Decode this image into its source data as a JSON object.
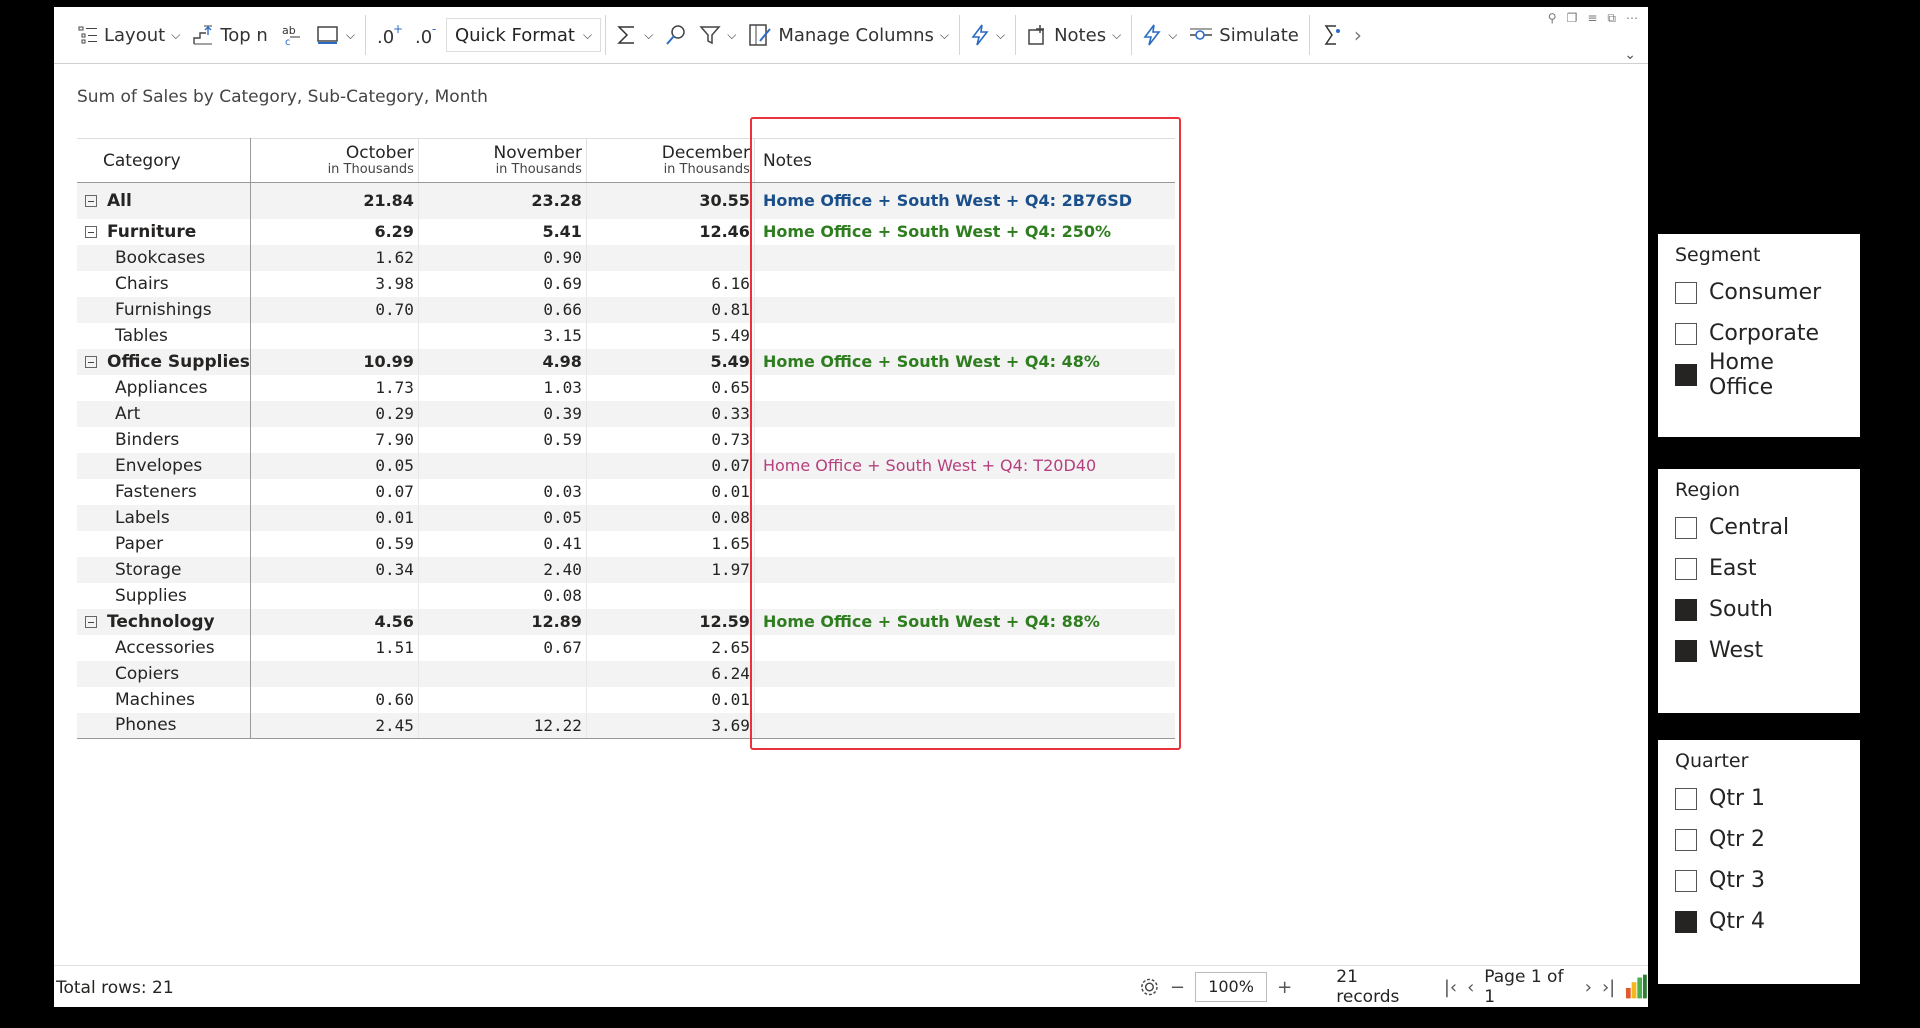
{
  "toolbar": {
    "layout": "Layout",
    "topn": "Top n",
    "quick_format": "Quick Format",
    "manage_columns": "Manage Columns",
    "notes": "Notes",
    "simulate": "Simulate"
  },
  "title": "Sum of Sales by Category, Sub-Category, Month",
  "table": {
    "category_header": "Category",
    "notes_header": "Notes",
    "columns": [
      {
        "month": "October",
        "unit": "in Thousands"
      },
      {
        "month": "November",
        "unit": "in Thousands"
      },
      {
        "month": "December",
        "unit": "in Thousands"
      }
    ],
    "rows": [
      {
        "label": "All",
        "level": 0,
        "v": [
          "21.84",
          "23.28",
          "30.55"
        ],
        "note": "Home Office + South West + Q4: 2B76SD",
        "note_color": "#1a4f8a"
      },
      {
        "label": "Furniture",
        "level": 0,
        "v": [
          "6.29",
          "5.41",
          "12.46"
        ],
        "note": "Home Office + South West + Q4: 250%",
        "note_color": "#2e7d1f"
      },
      {
        "label": "Bookcases",
        "level": 1,
        "v": [
          "1.62",
          "0.90",
          ""
        ],
        "note": ""
      },
      {
        "label": "Chairs",
        "level": 1,
        "v": [
          "3.98",
          "0.69",
          "6.16"
        ],
        "note": ""
      },
      {
        "label": "Furnishings",
        "level": 1,
        "v": [
          "0.70",
          "0.66",
          "0.81"
        ],
        "note": ""
      },
      {
        "label": "Tables",
        "level": 1,
        "v": [
          "",
          "3.15",
          "5.49"
        ],
        "note": ""
      },
      {
        "label": "Office Supplies",
        "level": 0,
        "v": [
          "10.99",
          "4.98",
          "5.49"
        ],
        "note": "Home Office + South West + Q4: 48%",
        "note_color": "#2e7d1f"
      },
      {
        "label": "Appliances",
        "level": 1,
        "v": [
          "1.73",
          "1.03",
          "0.65"
        ],
        "note": ""
      },
      {
        "label": "Art",
        "level": 1,
        "v": [
          "0.29",
          "0.39",
          "0.33"
        ],
        "note": ""
      },
      {
        "label": "Binders",
        "level": 1,
        "v": [
          "7.90",
          "0.59",
          "0.73"
        ],
        "note": ""
      },
      {
        "label": "Envelopes",
        "level": 1,
        "v": [
          "0.05",
          "",
          "0.07"
        ],
        "note": "Home Office + South West + Q4: T20D40",
        "note_color": "#b5407e"
      },
      {
        "label": "Fasteners",
        "level": 1,
        "v": [
          "0.07",
          "0.03",
          "0.01"
        ],
        "note": ""
      },
      {
        "label": "Labels",
        "level": 1,
        "v": [
          "0.01",
          "0.05",
          "0.08"
        ],
        "note": ""
      },
      {
        "label": "Paper",
        "level": 1,
        "v": [
          "0.59",
          "0.41",
          "1.65"
        ],
        "note": ""
      },
      {
        "label": "Storage",
        "level": 1,
        "v": [
          "0.34",
          "2.40",
          "1.97"
        ],
        "note": ""
      },
      {
        "label": "Supplies",
        "level": 1,
        "v": [
          "",
          "0.08",
          ""
        ],
        "note": ""
      },
      {
        "label": "Technology",
        "level": 0,
        "v": [
          "4.56",
          "12.89",
          "12.59"
        ],
        "note": "Home Office + South West + Q4: 88%",
        "note_color": "#2e7d1f"
      },
      {
        "label": "Accessories",
        "level": 1,
        "v": [
          "1.51",
          "0.67",
          "2.65"
        ],
        "note": ""
      },
      {
        "label": "Copiers",
        "level": 1,
        "v": [
          "",
          "",
          "6.24"
        ],
        "note": ""
      },
      {
        "label": "Machines",
        "level": 1,
        "v": [
          "0.60",
          "",
          "0.01"
        ],
        "note": ""
      },
      {
        "label": "Phones",
        "level": 1,
        "v": [
          "2.45",
          "12.22",
          "3.69"
        ],
        "note": ""
      }
    ]
  },
  "footer": {
    "total_rows": "Total rows: 21",
    "zoom": "100%",
    "records": "21 records",
    "page": "Page 1 of 1"
  },
  "slicers": [
    {
      "title": "Segment",
      "options": [
        {
          "label": "Consumer",
          "checked": false
        },
        {
          "label": "Corporate",
          "checked": false
        },
        {
          "label": "Home Office",
          "checked": true
        }
      ]
    },
    {
      "title": "Region",
      "options": [
        {
          "label": "Central",
          "checked": false
        },
        {
          "label": "East",
          "checked": false
        },
        {
          "label": "South",
          "checked": true
        },
        {
          "label": "West",
          "checked": true
        }
      ]
    },
    {
      "title": "Quarter",
      "options": [
        {
          "label": "Qtr 1",
          "checked": false
        },
        {
          "label": "Qtr 2",
          "checked": false
        },
        {
          "label": "Qtr 3",
          "checked": false
        },
        {
          "label": "Qtr 4",
          "checked": true
        }
      ]
    }
  ],
  "colors": {
    "accent_blue": "#2b6cc4",
    "highlight_red": "#e8323c"
  }
}
